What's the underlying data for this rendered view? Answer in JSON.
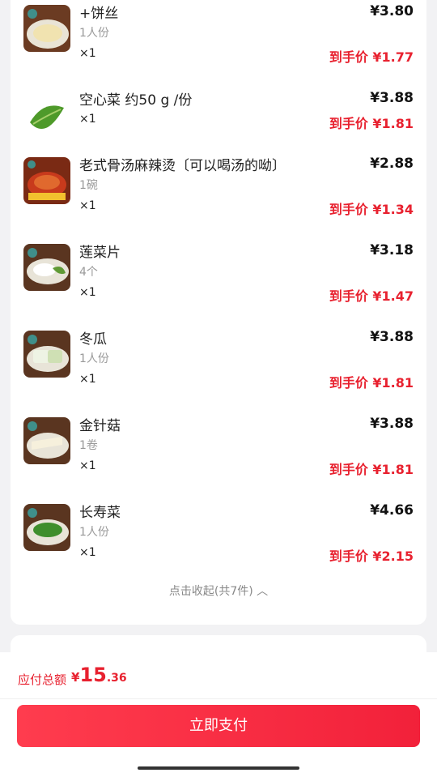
{
  "items": [
    {
      "name": "+饼丝",
      "spec": "1人份",
      "qty": "×1",
      "price": "¥3.80",
      "final": "到手价 ¥1.77",
      "img": "noodles"
    },
    {
      "name": "空心菜 约50 g /份",
      "spec": "",
      "qty": "×1",
      "price": "¥3.88",
      "final": "到手价 ¥1.81",
      "img": "greens"
    },
    {
      "name": "老式骨汤麻辣烫〔可以喝汤的呦〕",
      "spec": "1碗",
      "qty": "×1",
      "price": "¥2.88",
      "final": "到手价 ¥1.34",
      "img": "soup"
    },
    {
      "name": "莲菜片",
      "spec": "4个",
      "qty": "×1",
      "price": "¥3.18",
      "final": "到手价 ¥1.47",
      "img": "lotus"
    },
    {
      "name": "冬瓜",
      "spec": "1人份",
      "qty": "×1",
      "price": "¥3.88",
      "final": "到手价 ¥1.81",
      "img": "melon"
    },
    {
      "name": "金针菇",
      "spec": "1卷",
      "qty": "×1",
      "price": "¥3.88",
      "final": "到手价 ¥1.81",
      "img": "mushroom"
    },
    {
      "name": "长寿菜",
      "spec": "1人份",
      "qty": "×1",
      "price": "¥4.66",
      "final": "到手价 ¥2.15",
      "img": "veg"
    }
  ],
  "collapse_label": "点击收起(共7件) ︿",
  "footer": {
    "total_label": "应付总额",
    "currency": "¥",
    "amount_int": "15",
    "amount_dec": ".36",
    "pay_label": "立即支付"
  }
}
